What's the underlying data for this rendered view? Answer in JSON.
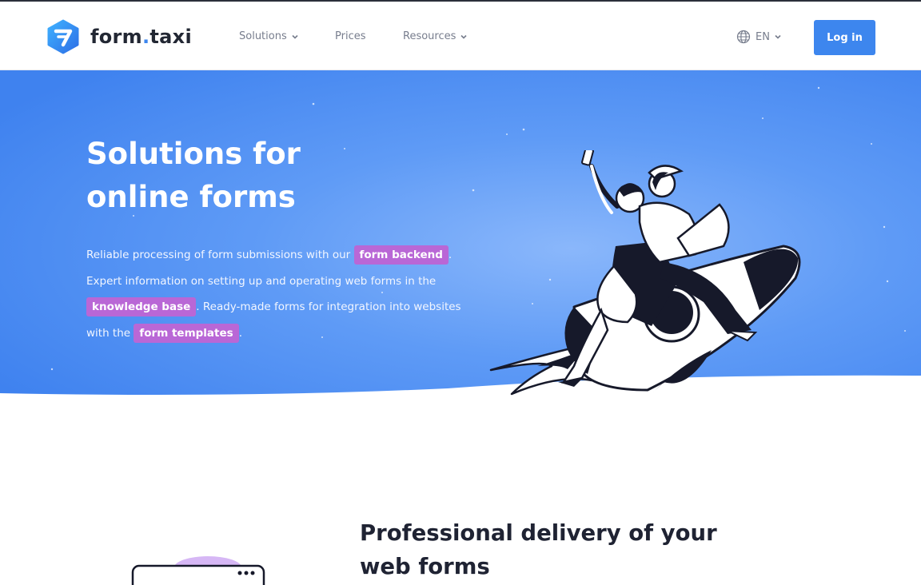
{
  "brand": {
    "name_main": "form",
    "name_dot": ".",
    "name_end": "taxi"
  },
  "nav": {
    "items": [
      {
        "label": "Solutions",
        "has_dropdown": true
      },
      {
        "label": "Prices",
        "has_dropdown": false
      },
      {
        "label": "Resources",
        "has_dropdown": true
      }
    ],
    "language": "EN",
    "login_label": "Log in"
  },
  "hero": {
    "title_line1": "Solutions for",
    "title_line2": "online forms",
    "text_1": "Reliable processing of form submissions with our ",
    "tag_1": "form backend",
    "text_2": ".",
    "text_3": "Expert information on setting up and operating web forms in the ",
    "tag_2": "knowledge base",
    "text_4": ". Ready-made forms for integration into websites with the ",
    "tag_3": "form templates",
    "text_5": "."
  },
  "section": {
    "title": "Professional delivery of your web forms"
  },
  "colors": {
    "accent": "#3d86ee",
    "hero_blue": "#4f8ef2",
    "tag_purple": "#b967d6",
    "text_dark": "#1f2333",
    "nav_text": "#777d8d"
  },
  "icons": [
    "logo-icon",
    "chevron-down-icon",
    "globe-icon"
  ]
}
